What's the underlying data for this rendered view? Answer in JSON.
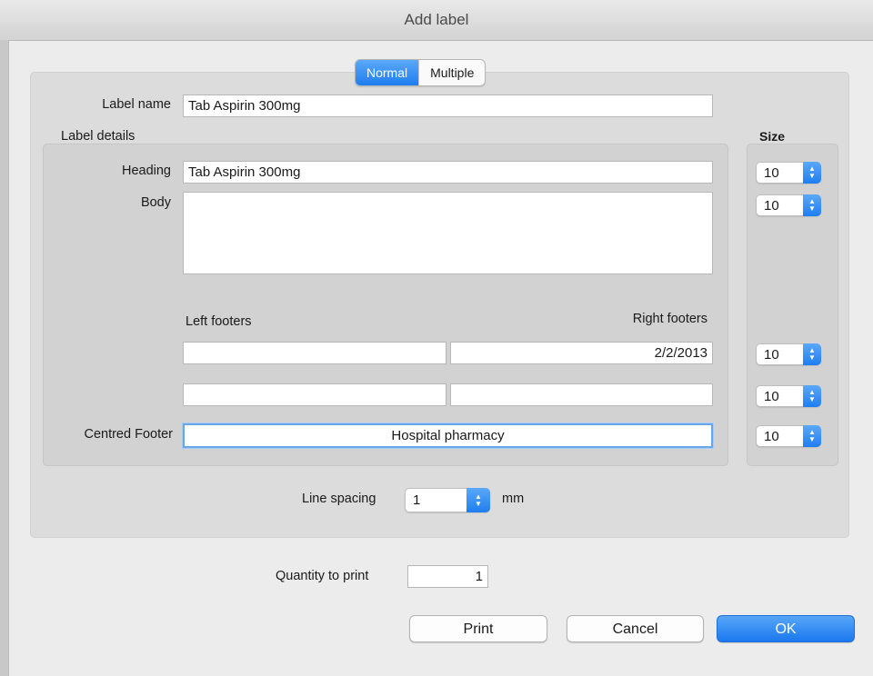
{
  "window": {
    "title": "Add label"
  },
  "mode_tabs": [
    {
      "label": "Normal",
      "selected": true
    },
    {
      "label": "Multiple",
      "selected": false
    }
  ],
  "label_name": {
    "label": "Label name",
    "value": "Tab Aspirin 300mg"
  },
  "label_details": {
    "section_label": "Label details",
    "heading": {
      "label": "Heading",
      "value": "Tab Aspirin 300mg"
    },
    "body": {
      "label": "Body",
      "value": ""
    },
    "left_footers_label": "Left footers",
    "right_footers_label": "Right footers",
    "footer_row_1": {
      "left": "",
      "right": "2/2/2013"
    },
    "footer_row_2": {
      "left": "",
      "right": ""
    },
    "centred_footer": {
      "label": "Centred Footer",
      "value": "Hospital pharmacy"
    }
  },
  "size": {
    "label": "Size",
    "heading": "10",
    "body": "10",
    "footer_row_1": "10",
    "footer_row_2": "10",
    "centred_footer": "10"
  },
  "line_spacing": {
    "label": "Line spacing",
    "value": "1",
    "unit": "mm"
  },
  "quantity": {
    "label": "Quantity to print",
    "value": "1"
  },
  "buttons": {
    "print": "Print",
    "cancel": "Cancel",
    "ok": "OK"
  },
  "colors": {
    "accent": "#1f7ef0",
    "window_bg": "#ececec"
  },
  "icons": {
    "select_arrow": "up-down-chevron-icon"
  }
}
